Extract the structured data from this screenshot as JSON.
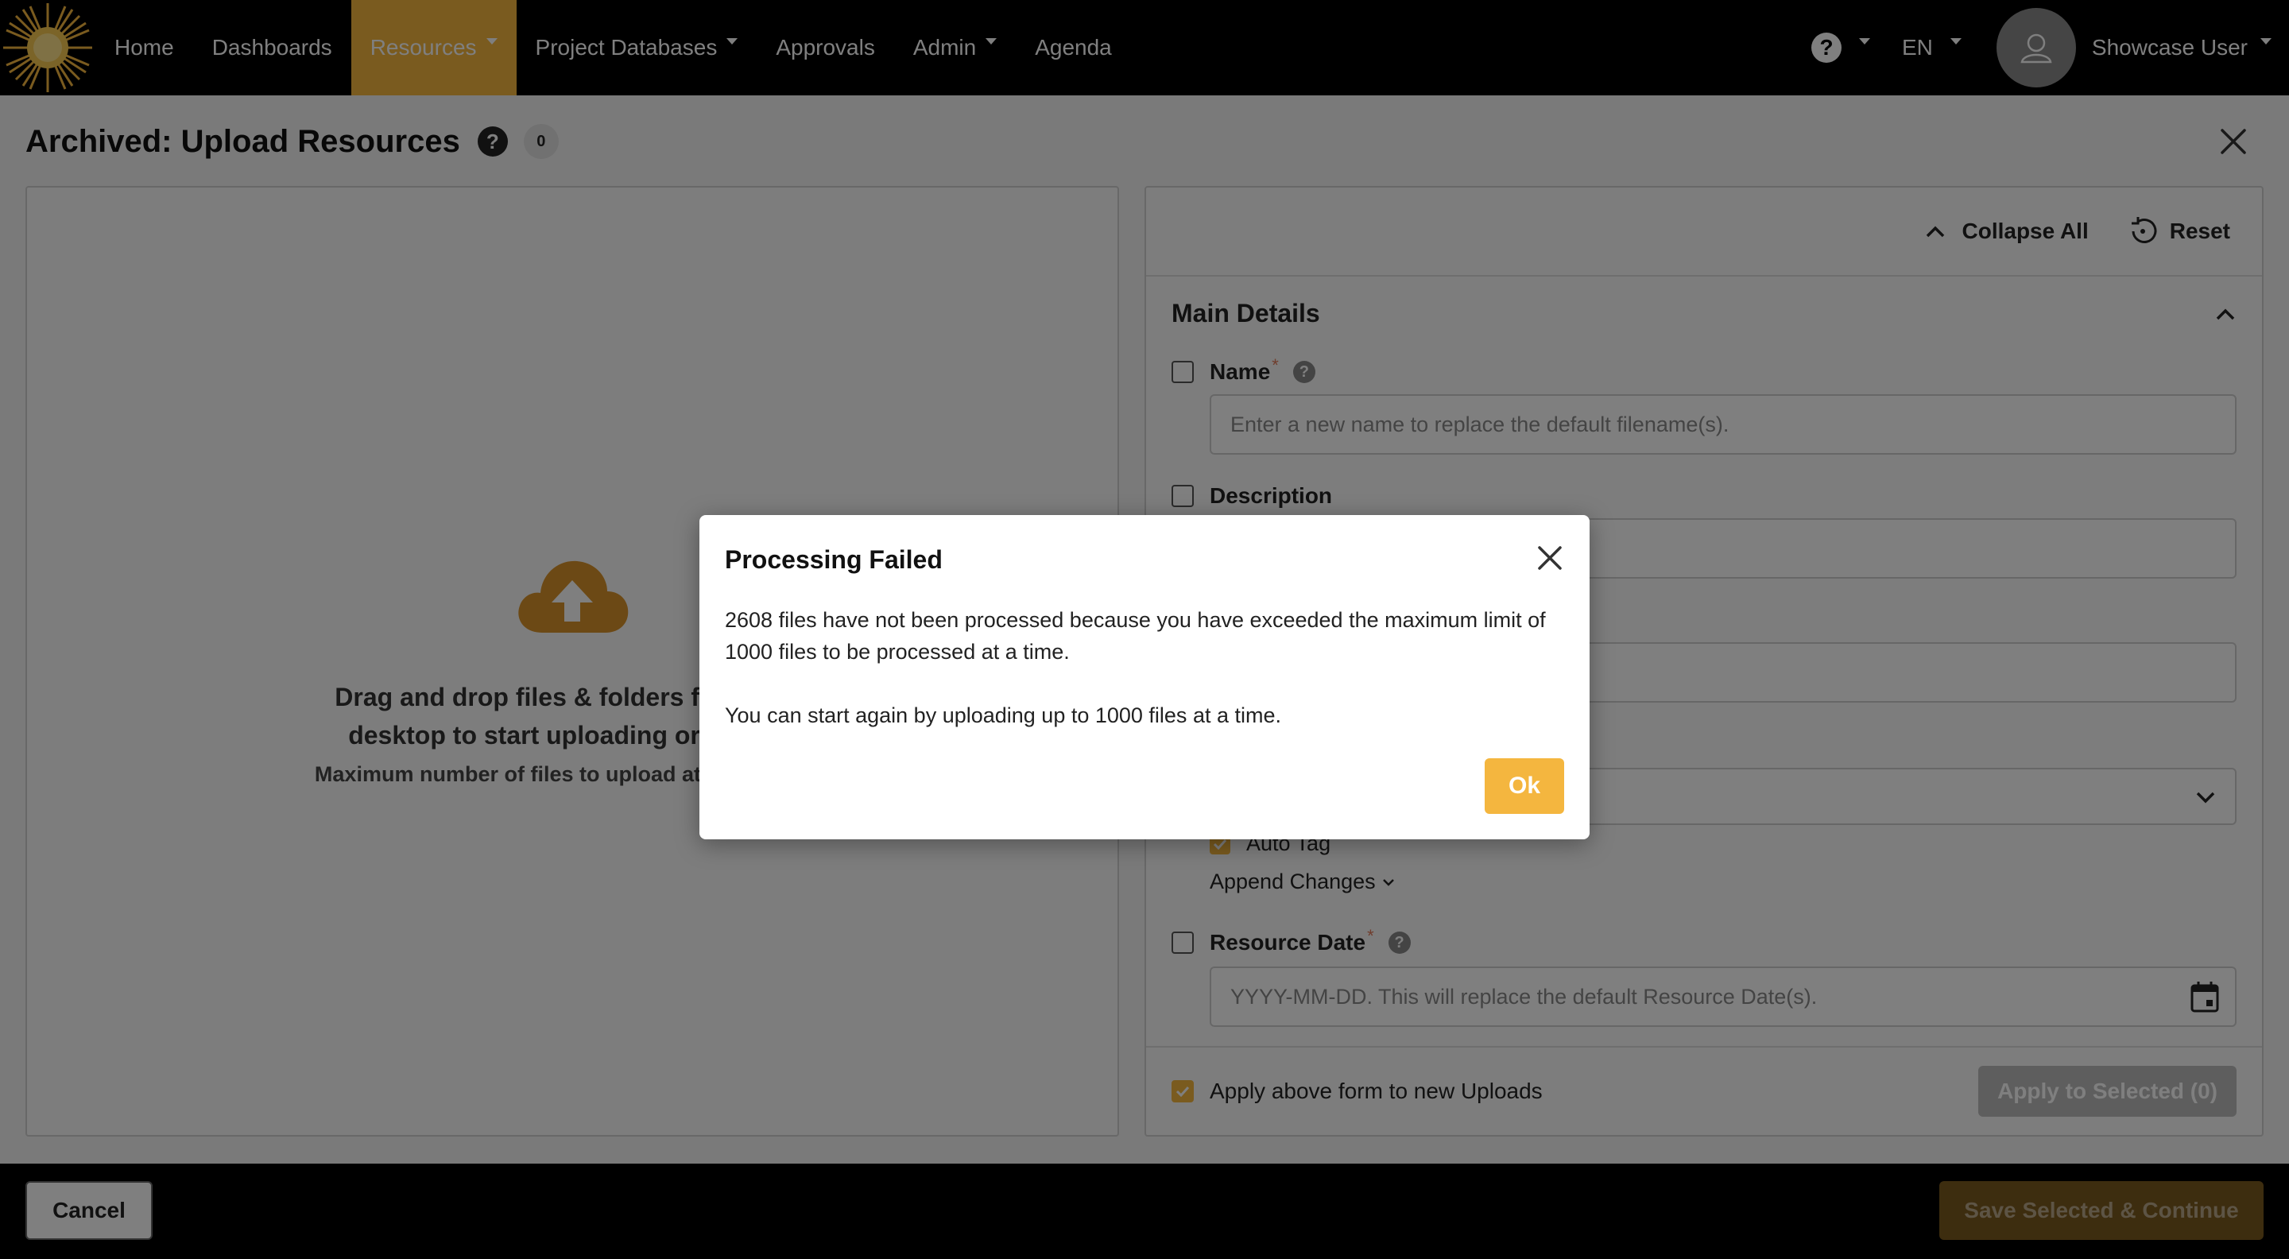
{
  "nav": {
    "items": [
      {
        "label": "Home",
        "active": false,
        "caret": false,
        "name": "nav-home"
      },
      {
        "label": "Dashboards",
        "active": false,
        "caret": false,
        "name": "nav-dashboards"
      },
      {
        "label": "Resources",
        "active": true,
        "caret": true,
        "name": "nav-resources"
      },
      {
        "label": "Project Databases",
        "active": false,
        "caret": true,
        "name": "nav-project-databases"
      },
      {
        "label": "Approvals",
        "active": false,
        "caret": false,
        "name": "nav-approvals"
      },
      {
        "label": "Admin",
        "active": false,
        "caret": true,
        "name": "nav-admin"
      },
      {
        "label": "Agenda",
        "active": false,
        "caret": false,
        "name": "nav-agenda"
      }
    ],
    "help_label": "?",
    "language": "EN",
    "user_name": "Showcase User",
    "accent_color": "#f4b63f"
  },
  "page": {
    "title": "Archived: Upload Resources",
    "help_label": "?",
    "count": "0"
  },
  "dropzone": {
    "line1": "Drag and drop files & folders from your",
    "line2": "desktop to start uploading or browse",
    "sub": "Maximum number of files to upload at a time: 1000"
  },
  "form": {
    "collapse_all": "Collapse All",
    "reset": "Reset",
    "section_title": "Main Details",
    "name_label": "Name",
    "name_placeholder": "Enter a new name to replace the default filename(s).",
    "required_mark": "*",
    "help_label": "?",
    "description_label": "Description",
    "auto_tag_label": "Auto Tag",
    "append_changes": "Append Changes",
    "resource_date_label": "Resource Date",
    "resource_date_placeholder": "YYYY-MM-DD. This will replace the default Resource Date(s).",
    "apply_new_uploads": "Apply above form to new Uploads",
    "apply_selected": "Apply to Selected (0)"
  },
  "actions": {
    "cancel": "Cancel",
    "save_continue": "Save Selected & Continue"
  },
  "modal": {
    "title": "Processing Failed",
    "message1": "2608 files have not been processed because you have exceeded the maximum limit of 1000 files to be processed at a time.",
    "message2": "You can start again by uploading up to 1000 files at a time.",
    "ok": "Ok"
  }
}
